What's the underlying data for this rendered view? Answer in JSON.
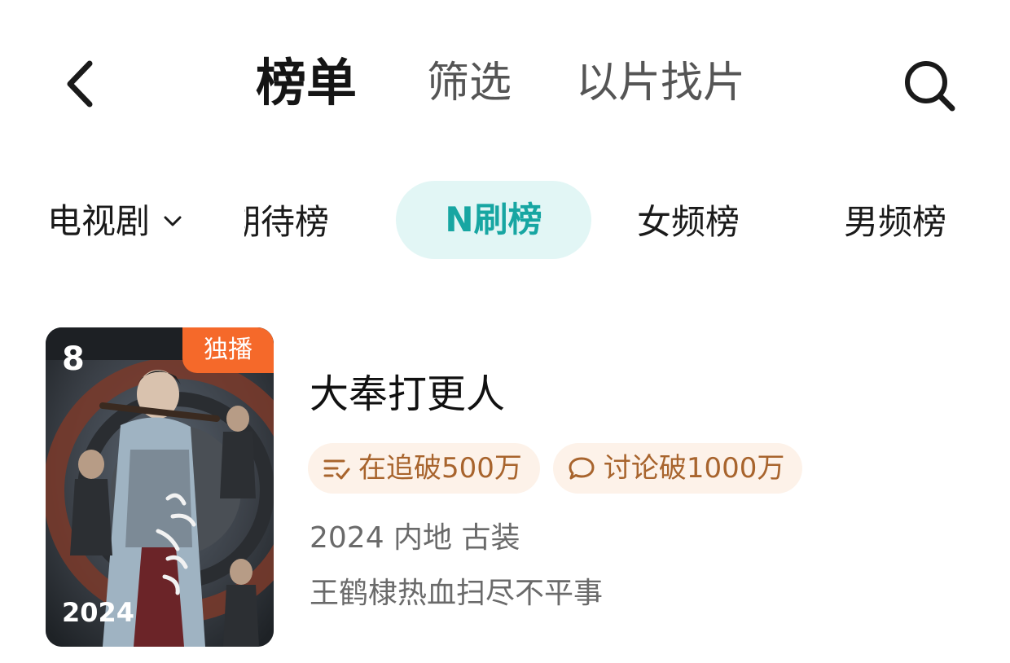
{
  "header": {
    "tabs": [
      {
        "label": "榜单",
        "active": true
      },
      {
        "label": "筛选",
        "active": false
      },
      {
        "label": "以片找片",
        "active": false
      }
    ],
    "back_icon": "chevron-left-icon",
    "search_icon": "search-icon"
  },
  "category": {
    "selected": "电视剧",
    "chevron_icon": "chevron-down-icon"
  },
  "chart_tabs": [
    {
      "label": "期待榜",
      "active": false
    },
    {
      "label": "N刷榜",
      "active": true
    },
    {
      "label": "女频榜",
      "active": false
    },
    {
      "label": "男频榜",
      "active": false
    }
  ],
  "colors": {
    "accent": "#17a6a2",
    "accent_bg": "#e2f6f5",
    "badge": "#f5692a",
    "tag_text": "#a8642d",
    "tag_bg": "#fdf2e9"
  },
  "item": {
    "rank": "8",
    "badge": "独播",
    "poster_year": "2024",
    "title": "大奉打更人",
    "tags": [
      {
        "icon": "list-check-icon",
        "text": "在追破500万"
      },
      {
        "icon": "chat-bubble-icon",
        "text": "讨论破1000万"
      }
    ],
    "meta": "2024 内地 古装",
    "description": "王鹤棣热血扫尽不平事"
  }
}
